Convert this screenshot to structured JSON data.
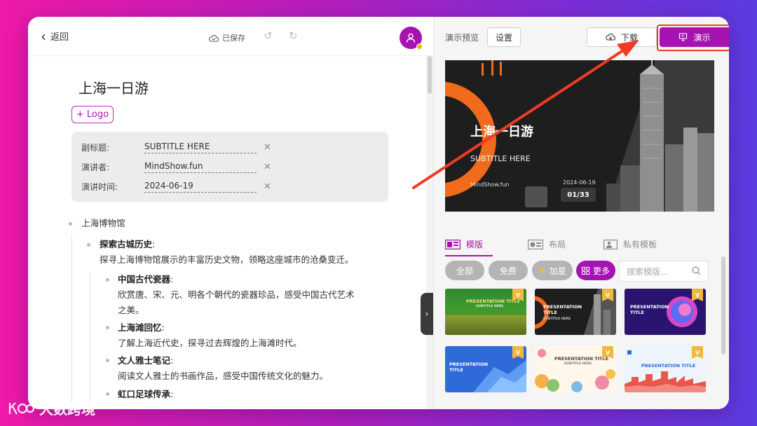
{
  "editor": {
    "back_label": "返回",
    "saved_label": "已保存",
    "title": "上海一日游",
    "logo_button": "+ Logo",
    "meta": [
      {
        "label": "副标题:",
        "value": "SUBTITLE HERE"
      },
      {
        "label": "演讲者:",
        "value": "MindShow.fun"
      },
      {
        "label": "演讲时间:",
        "value": "2024-06-19"
      }
    ],
    "outline": {
      "l1": "上海博物馆",
      "l2_title": "探索古城历史",
      "l2_colon": ":",
      "l2_text": "探寻上海博物馆展示的丰富历史文物，领略这座城市的沧桑变迁。",
      "items": [
        {
          "title": "中国古代瓷器",
          "colon": ":",
          "text1": "欣赏唐、宋、元、明各个朝代的瓷器珍品，感受中国古代艺术",
          "text2": "之美。"
        },
        {
          "title": "上海滩回忆",
          "colon": ":",
          "text1": "了解上海近代史，探寻过去辉煌的上海滩时代。"
        },
        {
          "title": "文人雅士笔记",
          "colon": ":",
          "text1": "阅读文人雅士的书画作品，感受中国传统文化的魅力。"
        },
        {
          "title": "虹口足球传承",
          "colon": ":"
        }
      ]
    }
  },
  "preview": {
    "title": "演示预览",
    "settings_button": "设置",
    "download_button": "下载",
    "present_button": "演示",
    "slide": {
      "title": "上海一日游",
      "subtitle": "SUBTITLE HERE",
      "brand": "MindShow.fun",
      "date": "2024-06-19",
      "page": "01/33"
    },
    "tabs": [
      "模版",
      "布局",
      "私有模板"
    ],
    "filters": [
      "全部",
      "免费",
      "加星",
      "更多"
    ],
    "search_placeholder": "搜索模版...",
    "templates": [
      {
        "title": "PRESENTATION TITLE",
        "subtitle": "SUBTITLE HERE"
      },
      {
        "title": "PRESENTATION\nTITLE",
        "subtitle": "SUBTITLE HERE"
      },
      {
        "title": "PRESENTATION\nTITLE",
        "subtitle": ""
      },
      {
        "title": "PRESENTATION\nTITLE",
        "subtitle": ""
      },
      {
        "title": "PRESENTATION TITLE",
        "subtitle": "SUBTITLE HERE"
      },
      {
        "title": "PRESENTATION TITLE",
        "subtitle": ""
      }
    ],
    "badge": "V"
  },
  "watermark": "大数跨境",
  "colors": {
    "brand": "#a514b0",
    "highlight": "#ee3b26",
    "background_start": "#ee1aa8",
    "background_end": "#5b3be0"
  },
  "icons": [
    "chevron-left-icon",
    "cloud-check-icon",
    "undo-icon",
    "redo-icon",
    "user-icon",
    "cloud-download-icon",
    "presentation-icon",
    "caret-down-icon",
    "search-icon",
    "star-icon",
    "grid-icon",
    "template-icon",
    "layout-icon",
    "private-template-icon"
  ]
}
